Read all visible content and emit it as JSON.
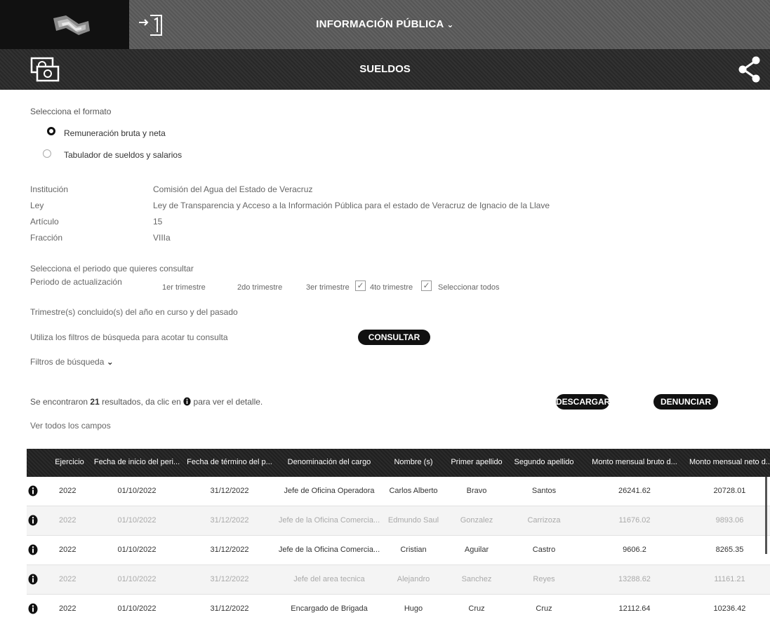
{
  "header": {
    "menu_title": "INFORMACIÓN PÚBLICA",
    "menu_chevron": "⌄",
    "section_title": "SUELDOS",
    "icons": {
      "logo": "logo-emblem",
      "exit": "exit-door-icon",
      "money": "money-bill-icon",
      "share": "share-icon"
    }
  },
  "format": {
    "label": "Selecciona el formato",
    "options": [
      {
        "label": "Remuneración bruta y neta",
        "selected": true
      },
      {
        "label": "Tabulador de sueldos y salarios",
        "selected": false
      }
    ]
  },
  "info": {
    "fields": [
      {
        "label": "Institución",
        "value": "Comisión del Agua del Estado de Veracruz"
      },
      {
        "label": "Ley",
        "value": "Ley de Transparencia y Acceso a la Información Pública para el estado de Veracruz de Ignacio de la Llave"
      },
      {
        "label": "Artículo",
        "value": "15"
      },
      {
        "label": "Fracción",
        "value": "VIIIa"
      }
    ]
  },
  "period": {
    "prompt": "Selecciona el periodo que quieres consultar",
    "label": "Periodo de actualización",
    "options": [
      {
        "label": "1er trimestre",
        "checked": false
      },
      {
        "label": "2do trimestre",
        "checked": false
      },
      {
        "label": "3er trimestre",
        "checked": true
      },
      {
        "label": "4to trimestre",
        "checked": true
      },
      {
        "label": "Seleccionar todos",
        "checked": false
      }
    ],
    "check_mark": "✓",
    "note": "Trimestre(s) concluido(s) del año en curso y del pasado"
  },
  "filters": {
    "prompt": "Utiliza los filtros de búsqueda para acotar tu consulta",
    "consult_button": "CONSULTAR",
    "toggle_label": "Filtros de búsqueda",
    "toggle_chevron": "⌄"
  },
  "results": {
    "prefix": "Se encontraron",
    "count": "21",
    "suffix_before_icon": "resultados, da clic en",
    "suffix_after_icon": "para ver el detalle.",
    "download_button": "DESCARGAR",
    "report_button": "DENUNCIAR",
    "show_all_fields": "Ver todos los campos"
  },
  "table": {
    "columns": [
      "Ejercicio",
      "Fecha de inicio del peri...",
      "Fecha de término del p...",
      "Denominación del cargo",
      "Nombre (s)",
      "Primer apellido",
      "Segundo apellido",
      "Monto mensual bruto d...",
      "Monto mensual neto d..."
    ],
    "rows": [
      {
        "faded": false,
        "cells": [
          "2022",
          "01/10/2022",
          "31/12/2022",
          "Jefe de Oficina Operadora",
          "Carlos Alberto",
          "Bravo",
          "Santos",
          "26241.62",
          "20728.01"
        ]
      },
      {
        "faded": true,
        "cells": [
          "2022",
          "01/10/2022",
          "31/12/2022",
          "Jefe de la Oficina Comercia...",
          "Edmundo Saul",
          "Gonzalez",
          "Carrizoza",
          "11676.02",
          "9893.06"
        ]
      },
      {
        "faded": false,
        "cells": [
          "2022",
          "01/10/2022",
          "31/12/2022",
          "Jefe de la Oficina Comercia...",
          "Cristian",
          "Aguilar",
          "Castro",
          "9606.2",
          "8265.35"
        ]
      },
      {
        "faded": true,
        "cells": [
          "2022",
          "01/10/2022",
          "31/12/2022",
          "Jefe del area tecnica",
          "Alejandro",
          "Sanchez",
          "Reyes",
          "13288.62",
          "11161.21"
        ]
      },
      {
        "faded": false,
        "cells": [
          "2022",
          "01/10/2022",
          "31/12/2022",
          "Encargado de Brigada",
          "Hugo",
          "Cruz",
          "Cruz",
          "12112.64",
          "10236.42"
        ]
      }
    ]
  }
}
